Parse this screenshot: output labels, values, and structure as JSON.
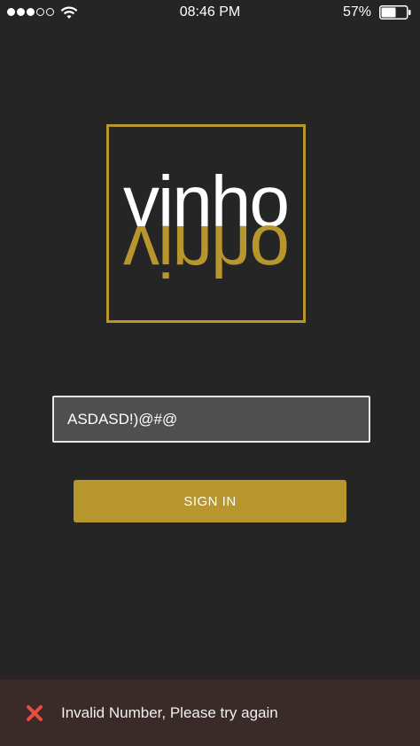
{
  "status_bar": {
    "time": "08:46 PM",
    "battery_percent": "57%",
    "battery_level": 0.57,
    "signal_bars_filled": 3,
    "signal_bars_total": 5,
    "icons": [
      "signal-dots",
      "wifi-icon",
      "battery-icon"
    ]
  },
  "logo": {
    "word_top": "vinho",
    "word_bottom_mirrored": "vinho",
    "frame_color": "#b8962e",
    "text_color_top": "#ffffff",
    "text_color_bottom": "#b8962e"
  },
  "login": {
    "phone_value": "ASDASD!)@#@",
    "sign_in_label": "SIGN IN",
    "button_color": "#b7962d"
  },
  "toast": {
    "icon": "close-icon",
    "message": "Invalid Number, Please try again",
    "icon_color": "#e74c3c"
  }
}
